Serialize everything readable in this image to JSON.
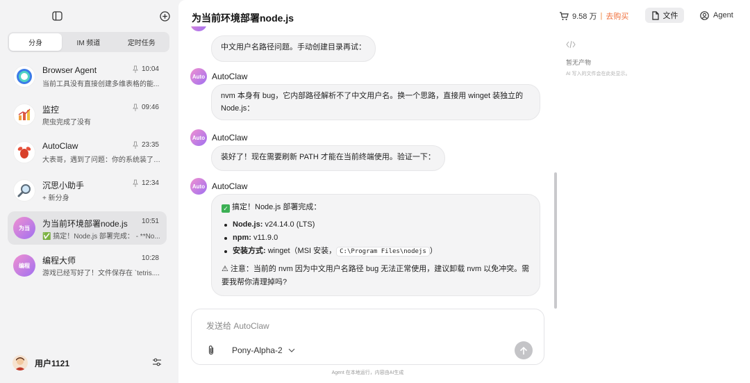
{
  "sidebar": {
    "tabs": [
      "分身",
      "IM 频道",
      "定时任务"
    ],
    "conversations": [
      {
        "title": "Browser Agent",
        "time": "10:04",
        "preview": "当前工具没有直接创建多维表格的能..."
      },
      {
        "title": "监控",
        "time": "09:46",
        "preview": "爬虫完成了没有"
      },
      {
        "title": "AutoClaw",
        "time": "23:35",
        "preview": "大表哥，遇到了问题：你的系统装了 ..."
      },
      {
        "title": "沉思小助手",
        "time": "12:34",
        "preview": "+ 新分身"
      },
      {
        "title": "为当前环境部署node.js",
        "time": "10:51",
        "avatar_text": "为当",
        "preview": "✅ 搞定！Node.js 部署完成： - **No..."
      },
      {
        "title": "编程大师",
        "time": "10:28",
        "avatar_text": "编程",
        "preview": "游戏已经写好了！文件保存在 `tetris...."
      }
    ],
    "user": {
      "name": "用户1121"
    }
  },
  "header": {
    "title": "为当前环境部署node.js",
    "credits": "9.58 万",
    "separator": "|",
    "buy_label": "去购买",
    "files_label": "文件",
    "agent_label": "Agent"
  },
  "chat": {
    "user_message": "中文用户名路径问题。手动创建目录再试：",
    "agent_name": "AutoClaw",
    "avatar_text": "Auto",
    "msg1": "nvm 本身有 bug，它内部路径解析不了中文用户名。换一个思路，直接用 winget 装独立的 Node.js：",
    "msg2": "装好了！现在需要刷新 PATH 才能在当前终端使用。验证一下：",
    "msg3": {
      "headline": "搞定！Node.js 部署完成：",
      "items": [
        {
          "key": "Node.js:",
          "value": " v24.14.0 (LTS)"
        },
        {
          "key": "npm:",
          "value": " v11.9.0"
        },
        {
          "key": "安装方式:",
          "value": " winget（MSI 安装，",
          "code": "C:\\Program Files\\nodejs",
          "tail": "）"
        }
      ],
      "note": "⚠ 注意：当前的 nvm 因为中文用户名路径 bug 无法正常使用，建议卸载 nvm 以免冲突。需要我帮你清理掉吗?"
    }
  },
  "artifacts": {
    "empty_title": "暂无产物",
    "empty_desc": "AI 写入的文件会在此处显示。"
  },
  "composer": {
    "placeholder": "发送给 AutoClaw",
    "model": "Pony-Alpha-2"
  },
  "footer": {
    "note": "Agent 在本地运行，内容由AI生成"
  },
  "colors": {
    "accent_orange": "#f0703c",
    "avatar_gradient_start": "#f090d0",
    "avatar_gradient_end": "#a070f0",
    "check_green": "#3cb054"
  }
}
